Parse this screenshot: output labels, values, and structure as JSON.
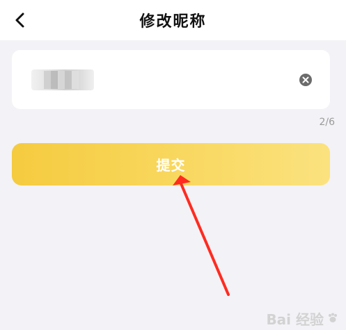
{
  "header": {
    "title": "修改昵称",
    "back_icon": "back-chevron-icon"
  },
  "form": {
    "nickname_value": "昵称",
    "clear_icon": "clear-circle-icon",
    "counter": "2/6",
    "submit_label": "提交"
  },
  "watermark": {
    "text": "Bai 经验"
  },
  "colors": {
    "page_background": "#f3f2f6",
    "header_background": "#ffffff",
    "button_start": "#f5cb3f",
    "button_end": "#fbe27f",
    "arrow": "#ff2b20"
  }
}
